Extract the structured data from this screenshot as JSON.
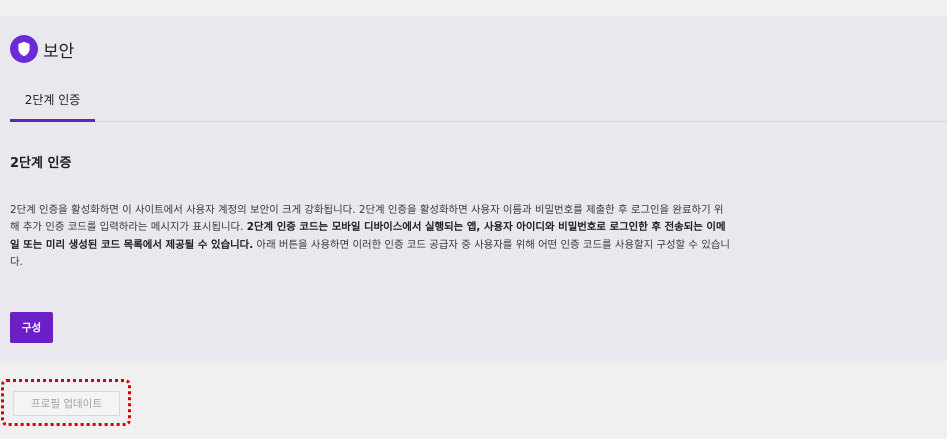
{
  "panel": {
    "icon": "shield-icon",
    "title": "보안",
    "accent_color": "#6c2bd9"
  },
  "tabs": [
    {
      "label": "2단계 인증",
      "active": true
    }
  ],
  "section": {
    "title": "2단계 인증",
    "text_1": "2단계 인증을 활성화하면 이 사이트에서 사용자 계정의 보안이 크게 강화됩니다. 2단계 인증을 활성화하면 사용자 이름과 비밀번호를 제출한 후 로그인을 완료하기 위해 추가 인증 코드를 입력하라는 메시지가 표시됩니다. ",
    "text_bold": "2단계 인증 코드는 모바일 디바이스에서 실행되는 앱, 사용자 아이디와 비밀번호로 로그인한 후 전송되는 이메일 또는 미리 생성된 코드 목록에서 제공될 수 있습니다.",
    "text_2": " 아래 버튼을 사용하면 이러한 인증 코드 공급자 중 사용자를 위해 어떤 인증 코드를 사용할지 구성할 수 있습니다.",
    "configure_label": "구성",
    "button_color": "#6a20c6"
  },
  "footer": {
    "update_profile_label": "프로필 업데이트",
    "highlight_color": "#d10000"
  }
}
